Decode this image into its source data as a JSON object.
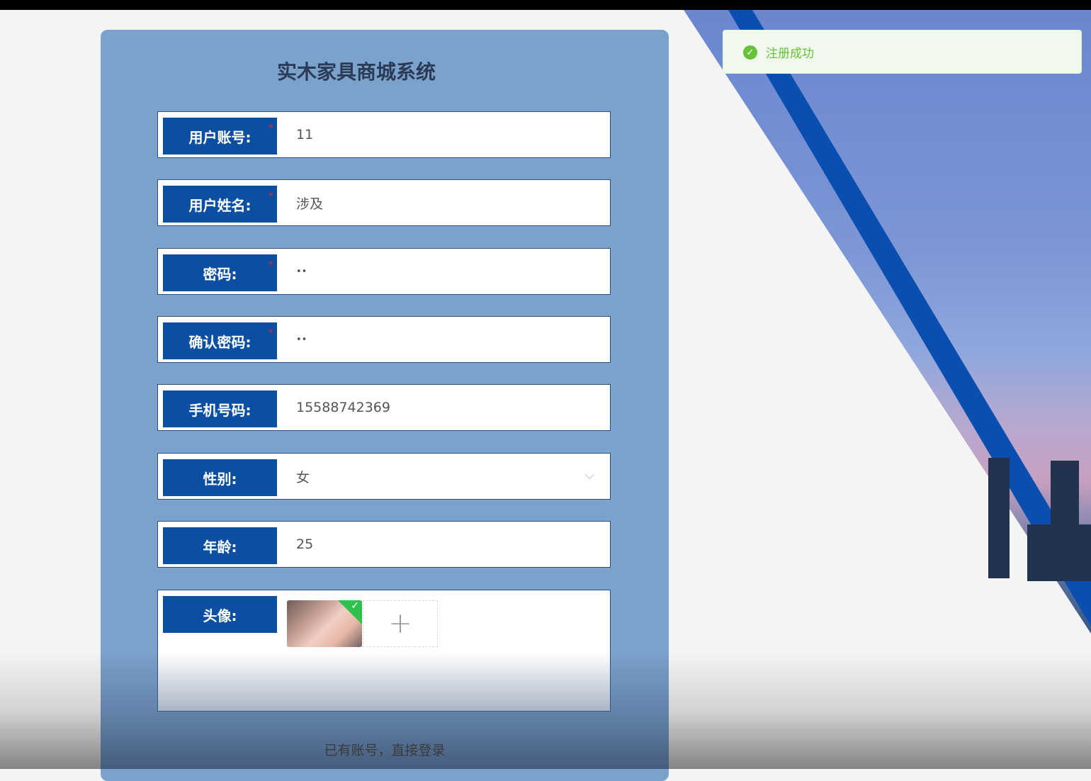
{
  "app": {
    "title": "实木家具商城系统"
  },
  "form": {
    "account": {
      "label": "用户账号:",
      "value": "11",
      "required": "*"
    },
    "name": {
      "label": "用户姓名:",
      "value": "涉及",
      "required": "*"
    },
    "password": {
      "label": "密码:",
      "value": "••",
      "required": "*"
    },
    "confirm": {
      "label": "确认密码:",
      "value": "••",
      "required": "*"
    },
    "phone": {
      "label": "手机号码:",
      "value": "15588742369"
    },
    "gender": {
      "label": "性别:",
      "value": "女",
      "chevron": "⌵"
    },
    "age": {
      "label": "年龄:",
      "value": "25"
    },
    "avatar": {
      "label": "头像:",
      "add_glyph": "+",
      "check_glyph": "✓"
    },
    "login_link": "已有账号，直接登录"
  },
  "toast": {
    "icon_glyph": "✓",
    "text": "注册成功",
    "color": "#67c23a"
  },
  "colors": {
    "label_bg": "#0b4fa3",
    "panel_bg": "#7ba2cb",
    "stripe": "#0a4fb0"
  }
}
